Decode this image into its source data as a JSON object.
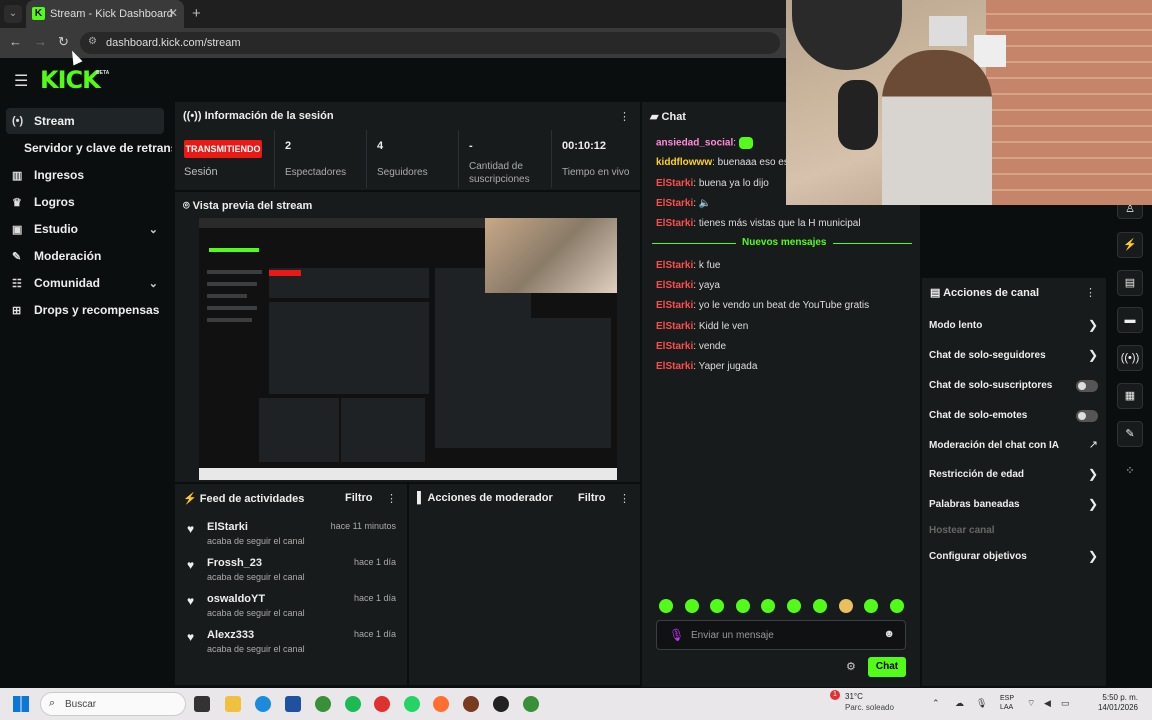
{
  "browser": {
    "tab_title": "Stream - Kick Dashboard",
    "favicon_letter": "K",
    "url": "dashboard.kick.com/stream",
    "new_tab": "+",
    "close": "✕"
  },
  "header": {
    "logo": "KICK",
    "beta": "BETA"
  },
  "sidebar": {
    "items": [
      {
        "label": "Stream",
        "icon": "broadcast-icon"
      },
      {
        "label": "Servidor y clave de retransmisión",
        "icon": ""
      },
      {
        "label": "Ingresos",
        "icon": "chart-icon"
      },
      {
        "label": "Logros",
        "icon": "trophy-icon"
      },
      {
        "label": "Estudio",
        "icon": "video-icon"
      },
      {
        "label": "Moderación",
        "icon": "wrench-icon"
      },
      {
        "label": "Comunidad",
        "icon": "people-icon"
      },
      {
        "label": "Drops y recompensas",
        "icon": "gift-icon"
      }
    ]
  },
  "session_info": {
    "title": "Información de la sesión",
    "live_badge": "TRANSMITIENDO",
    "session_label": "Sesión",
    "stats": [
      {
        "value": "2",
        "label": "Espectadores"
      },
      {
        "value": "4",
        "label": "Seguidores"
      },
      {
        "value": "-",
        "label": "Cantidad de suscripciones"
      },
      {
        "value": "00:10:12",
        "label": "Tiempo en vivo"
      }
    ]
  },
  "preview": {
    "title": "Vista previa del stream"
  },
  "activity_feed": {
    "title": "Feed de actividades",
    "filter": "Filtro",
    "items": [
      {
        "name": "ElStarki",
        "sub": "acaba de seguir el canal",
        "time": "hace 11 minutos"
      },
      {
        "name": "Frossh_23",
        "sub": "acaba de seguir el canal",
        "time": "hace 1 día"
      },
      {
        "name": "oswaldoYT",
        "sub": "acaba de seguir el canal",
        "time": "hace 1 día"
      },
      {
        "name": "Alexz333",
        "sub": "acaba de seguir el canal",
        "time": "hace 1 día"
      }
    ]
  },
  "mod_actions": {
    "title": "Acciones de moderador",
    "filter": "Filtro"
  },
  "chat": {
    "title": "Chat",
    "messages": [
      {
        "user": "ansiedad_social",
        "text": "",
        "color": "#ff8ad8"
      },
      {
        "user": "kiddflowww",
        "text": "buenaaa eso es",
        "color": "#ffd21f"
      },
      {
        "user": "ElStarki",
        "text": "buena ya lo dijo",
        "color": "#ff4d4d"
      },
      {
        "user": "ElStarki",
        "text": "",
        "color": "#ff4d4d"
      },
      {
        "user": "ElStarki",
        "text": "tienes más vistas que la H municipal",
        "color": "#ff4d4d"
      }
    ],
    "new_messages_label": "Nuevos mensajes",
    "new_messages": [
      {
        "user": "ElStarki",
        "text": "k fue",
        "color": "#ff4d4d"
      },
      {
        "user": "ElStarki",
        "text": "yaya",
        "color": "#ff4d4d"
      },
      {
        "user": "ElStarki",
        "text": "yo le vendo un beat de YouTube gratis",
        "color": "#ff4d4d"
      },
      {
        "user": "ElStarki",
        "text": "Kidd le ven",
        "color": "#ff4d4d"
      },
      {
        "user": "ElStarki",
        "text": "vende",
        "color": "#ff4d4d"
      },
      {
        "user": "ElStarki",
        "text": "Yaper jugada",
        "color": "#ff4d4d"
      }
    ],
    "input_placeholder": "Enviar un mensaje",
    "send_label": "Chat"
  },
  "channel_actions": {
    "title": "Acciones de canal",
    "items": [
      {
        "label": "Modo lento",
        "type": "chevron"
      },
      {
        "label": "Chat de solo-seguidores",
        "type": "chevron"
      },
      {
        "label": "Chat de solo-suscriptores",
        "type": "toggle"
      },
      {
        "label": "Chat de solo-emotes",
        "type": "toggle"
      },
      {
        "label": "Moderación del chat con IA",
        "type": "external"
      },
      {
        "label": "Restricción de edad",
        "type": "chevron"
      },
      {
        "label": "Palabras baneadas",
        "type": "chevron"
      },
      {
        "label": "Hostear canal",
        "type": "disabled"
      },
      {
        "label": "Configurar objetivos",
        "type": "chevron"
      }
    ]
  },
  "taskbar": {
    "search_label": "Buscar",
    "weather_temp": "31°C",
    "weather_desc": "Parc. soleado",
    "weather_badge": "1",
    "lang_line1": "ESP",
    "lang_line2": "LAA",
    "time": "5:50 p. m.",
    "date": "14/01/2026"
  },
  "colors": {
    "accent": "#53fc18",
    "live": "#e91916"
  }
}
